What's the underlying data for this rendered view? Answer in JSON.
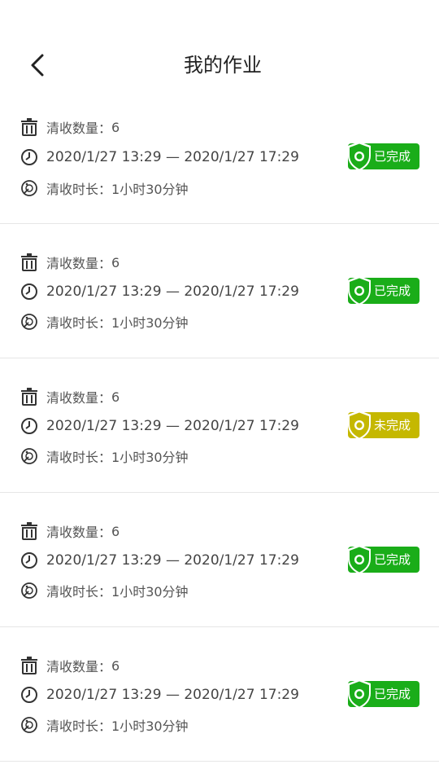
{
  "header": {
    "title": "我的作业"
  },
  "colors": {
    "done": "#1aad19",
    "pending": "#c5b800"
  },
  "records": [
    {
      "quantity_label": "清收数量：",
      "quantity": "6",
      "time_range": "2020/1/27 13:29 — 2020/1/27 17:29",
      "duration_label": "清收时长：",
      "duration": "1小时30分钟",
      "status": "已完成",
      "status_type": "done"
    },
    {
      "quantity_label": "清收数量：",
      "quantity": "6",
      "time_range": "2020/1/27 13:29 — 2020/1/27 17:29",
      "duration_label": "清收时长：",
      "duration": "1小时30分钟",
      "status": "已完成",
      "status_type": "done"
    },
    {
      "quantity_label": "清收数量：",
      "quantity": "6",
      "time_range": "2020/1/27 13:29 — 2020/1/27 17:29",
      "duration_label": "清收时长：",
      "duration": "1小时30分钟",
      "status": "未完成",
      "status_type": "pending"
    },
    {
      "quantity_label": "清收数量：",
      "quantity": "6",
      "time_range": "2020/1/27 13:29 — 2020/1/27 17:29",
      "duration_label": "清收时长：",
      "duration": "1小时30分钟",
      "status": "已完成",
      "status_type": "done"
    },
    {
      "quantity_label": "清收数量：",
      "quantity": "6",
      "time_range": "2020/1/27 13:29 — 2020/1/27 17:29",
      "duration_label": "清收时长：",
      "duration": "1小时30分钟",
      "status": "已完成",
      "status_type": "done"
    }
  ]
}
